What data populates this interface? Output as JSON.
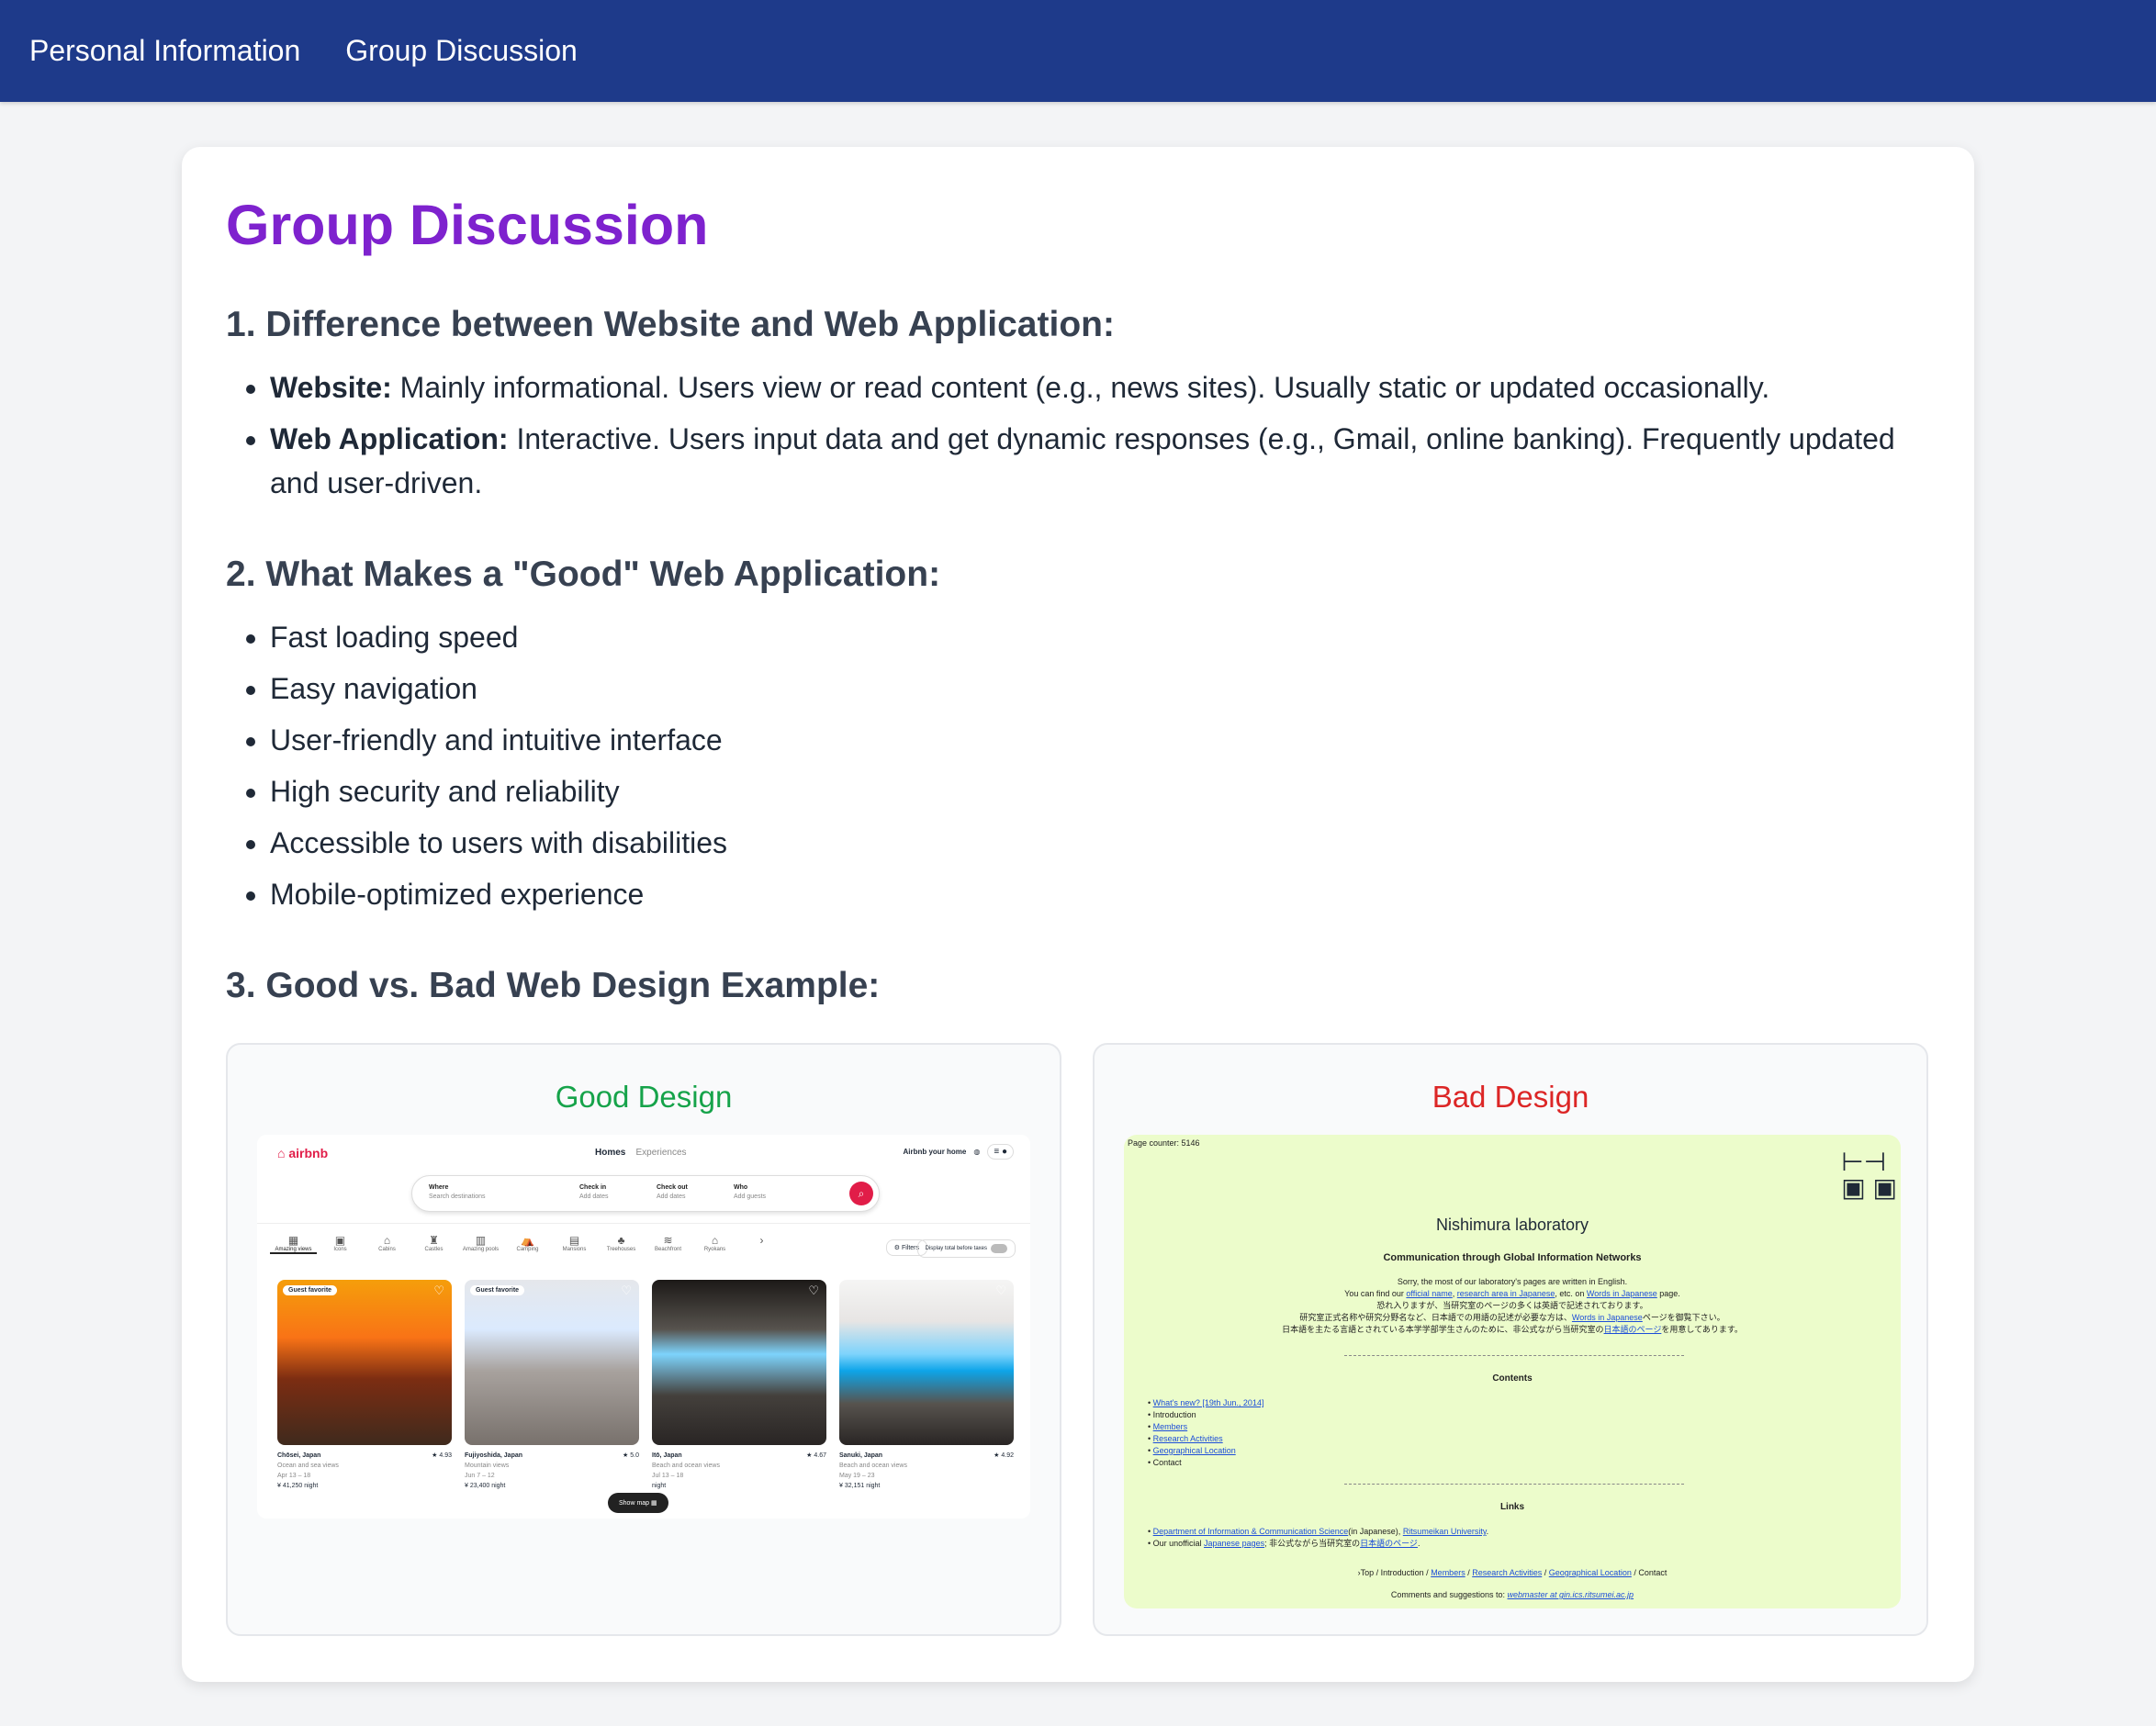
{
  "nav": {
    "items": [
      "Personal Information",
      "Group Discussion"
    ]
  },
  "title": "Group Discussion",
  "section1": {
    "heading": "1. Difference between Website and Web Application:",
    "website_label": "Website:",
    "website_text": " Mainly informational. Users view or read content (e.g., news sites). Usually static or updated occasionally.",
    "webapp_label": "Web Application:",
    "webapp_text": " Interactive. Users input data and get dynamic responses (e.g., Gmail, online banking). Frequently updated and user-driven."
  },
  "section2": {
    "heading": "2. What Makes a \"Good\" Web Application:",
    "items": [
      "Fast loading speed",
      "Easy navigation",
      "User-friendly and intuitive interface",
      "High security and reliability",
      "Accessible to users with disabilities",
      "Mobile-optimized experience"
    ]
  },
  "section3": {
    "heading": "3. Good vs. Bad Web Design Example:",
    "good_title": "Good Design",
    "bad_title": "Bad Design"
  },
  "airbnb": {
    "logo": "airbnb",
    "nav_homes": "Homes",
    "nav_experiences": "Experiences",
    "host": "Airbnb your home",
    "search": {
      "where_label": "Where",
      "where_ph": "Search destinations",
      "checkin_label": "Check in",
      "checkin_ph": "Add dates",
      "checkout_label": "Check out",
      "checkout_ph": "Add dates",
      "who_label": "Who",
      "who_ph": "Add guests"
    },
    "categories": [
      "Amazing views",
      "Icons",
      "Cabins",
      "Castles",
      "Amazing pools",
      "Camping",
      "Mansions",
      "Treehouses",
      "Beachfront",
      "Ryokans"
    ],
    "filters": "Filters",
    "taxes": "Display total before taxes",
    "show_map": "Show map",
    "listings": [
      {
        "place": "Chōsei, Japan",
        "rating": "★ 4.93",
        "desc": "Ocean and sea views",
        "dates": "Apr 13 – 18",
        "price": "¥ 41,250 night",
        "badge": "Guest favorite"
      },
      {
        "place": "Fujiyoshida, Japan",
        "rating": "★ 5.0",
        "desc": "Mountain views",
        "dates": "Jun 7 – 12",
        "price": "¥ 23,400 night",
        "badge": "Guest favorite"
      },
      {
        "place": "Itō, Japan",
        "rating": "★ 4.67",
        "desc": "Beach and ocean views",
        "dates": "Jul 13 – 18",
        "price": "night",
        "badge": ""
      },
      {
        "place": "Sanuki, Japan",
        "rating": "★ 4.92",
        "desc": "Beach and ocean views",
        "dates": "May 19 – 23",
        "price": "¥ 32,151 night",
        "badge": ""
      }
    ]
  },
  "lab": {
    "counter": "Page counter: 5146",
    "title": "Nishimura laboratory",
    "subtitle": "Communication through Global Information Networks",
    "line1": "Sorry, the most of our laboratory's pages are written in English.",
    "line2a": "You can find our ",
    "link_official": "official name",
    "comma1": ", ",
    "link_area": "research area in Japanese",
    "line2b": ", etc. on ",
    "link_words": "Words in Japanese",
    "line2c": " page.",
    "jp1": "恐れ入りますが、当研究室のページの多くは英語で記述されております。",
    "jp2a": "研究室正式名称や研究分野名など、日本語での用語の記述が必要な方は、",
    "jp2link": "Words in Japanese",
    "jp2b": "ページを御覧下さい。",
    "jp3a": "日本語を主たる言語とされている本学学部学生さんのために、非公式ながら当研究室の",
    "jp3link": "日本語のページ",
    "jp3b": "を用意してあります。",
    "contents_heading": "Contents",
    "contents": [
      "What's new? [19th Jun., 2014]",
      "Introduction",
      "Members",
      "Research Activities",
      "Geographical Location",
      "Contact"
    ],
    "links_heading": "Links",
    "link1a": "Department of Information & Communication Science",
    "link1b": "(in Japanese), ",
    "link1c": "Ritsumeikan University",
    "link1d": ".",
    "link2a": "Our unofficial ",
    "link2b": "Japanese pages",
    "link2c": "; 非公式ながら当研究室の",
    "link2d": "日本語のページ",
    "link2e": ".",
    "footer_nav": [
      "Top",
      "Introduction",
      "Members",
      "Research Activities",
      "Geographical Location",
      "Contact"
    ],
    "comments": "Comments and suggestions to: ",
    "email": "webmaster at gin.ics.ritsumei.ac.jp"
  }
}
